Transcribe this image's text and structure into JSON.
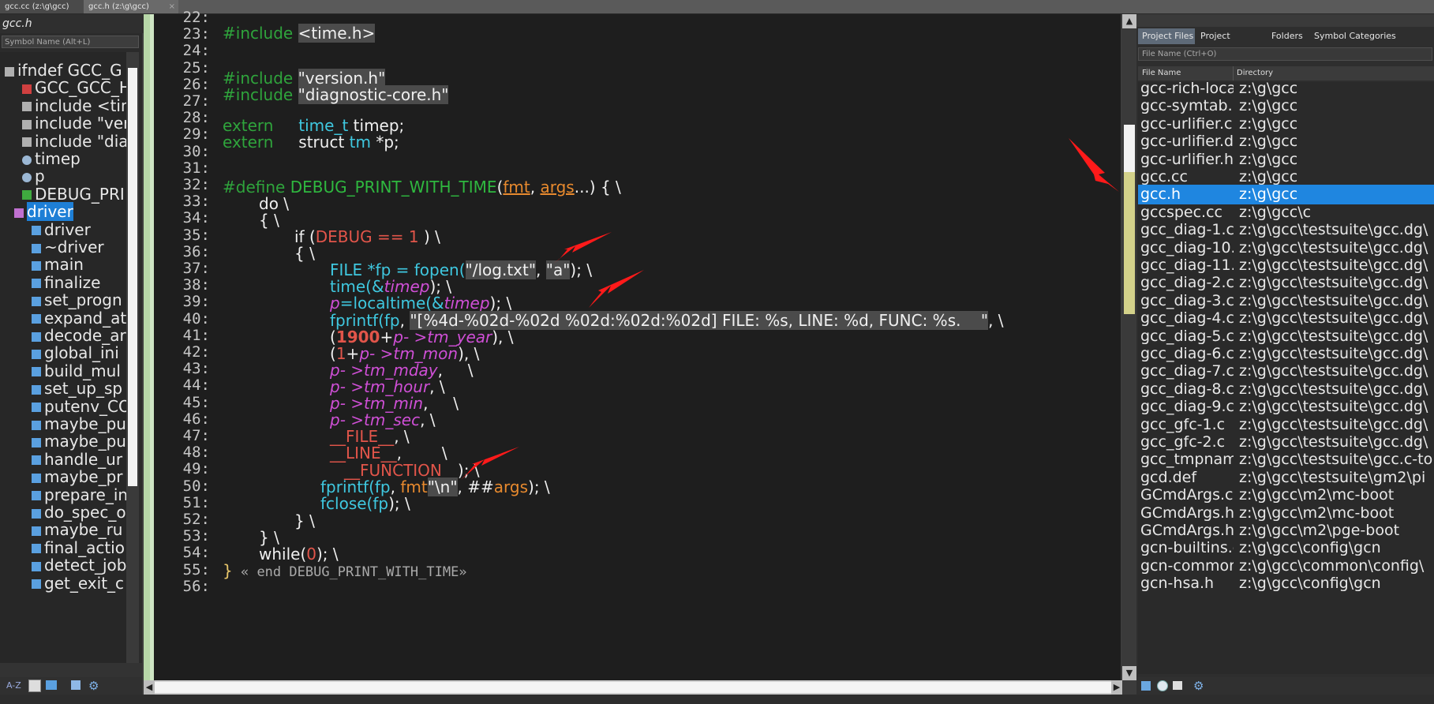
{
  "tabs": [
    {
      "label": "gcc.cc (z:\\g\\gcc)"
    },
    {
      "label": "gcc.h (z:\\g\\gcc)",
      "close": "×"
    }
  ],
  "left_panel": {
    "file_name": "gcc.h",
    "search_placeholder": "Symbol Name (Alt+L)",
    "symbols": [
      {
        "label": "ifndef GCC_G",
        "icon": "hash-icon"
      },
      {
        "label": "GCC_GCC_H",
        "icon": "define-icon"
      },
      {
        "label": "include <tim",
        "icon": "hash-icon"
      },
      {
        "label": "include \"ver",
        "icon": "hash-icon"
      },
      {
        "label": "include \"dia",
        "icon": "hash-icon"
      },
      {
        "label": "timep",
        "icon": "variable-icon"
      },
      {
        "label": "p",
        "icon": "variable-icon"
      },
      {
        "label": "DEBUG_PRI",
        "icon": "macro-icon"
      },
      {
        "label": "driver",
        "icon": "class-icon"
      },
      {
        "label": "driver",
        "icon": "method-icon"
      },
      {
        "label": "~driver",
        "icon": "method-icon"
      },
      {
        "label": "main",
        "icon": "method-icon"
      },
      {
        "label": "finalize",
        "icon": "method-icon"
      },
      {
        "label": "set_progn",
        "icon": "method-icon"
      },
      {
        "label": "expand_at",
        "icon": "method-icon"
      },
      {
        "label": "decode_ar",
        "icon": "method-icon"
      },
      {
        "label": "global_ini",
        "icon": "method-icon"
      },
      {
        "label": "build_mul",
        "icon": "method-icon"
      },
      {
        "label": "set_up_sp",
        "icon": "method-icon"
      },
      {
        "label": "putenv_CO",
        "icon": "method-icon"
      },
      {
        "label": "maybe_pu",
        "icon": "method-icon"
      },
      {
        "label": "maybe_pu",
        "icon": "method-icon"
      },
      {
        "label": "handle_ur",
        "icon": "method-icon"
      },
      {
        "label": "maybe_pr",
        "icon": "method-icon"
      },
      {
        "label": "prepare_in",
        "icon": "method-icon"
      },
      {
        "label": "do_spec_o",
        "icon": "method-icon"
      },
      {
        "label": "maybe_ru",
        "icon": "method-icon"
      },
      {
        "label": "final_actio",
        "icon": "method-icon"
      },
      {
        "label": "detect_job",
        "icon": "method-icon"
      },
      {
        "label": "get_exit_c",
        "icon": "method-icon"
      }
    ],
    "selected_index": 8,
    "toolbar": {
      "az": "A-Z"
    }
  },
  "editor": {
    "line_numbers": [
      "22:",
      "23:",
      "24:",
      "25:",
      "26:",
      "27:",
      "28:",
      "29:",
      "30:",
      "31:",
      "32:",
      "33:",
      "34:",
      "35:",
      "36:",
      "37:",
      "38:",
      "39:",
      "40:",
      "41:",
      "42:",
      "43:",
      "44:",
      "45:",
      "46:",
      "47:",
      "48:",
      "49:",
      "50:",
      "51:",
      "52:",
      "53:",
      "54:",
      "55:",
      "56:"
    ],
    "lines": {
      "l23_kw": "#include",
      "l23_str": "<time.h>",
      "l26_kw": "#include",
      "l26_str": "\"version.h\"",
      "l27_kw": "#include",
      "l27_str": "\"diagnostic-core.h\"",
      "l29_kw": "extern",
      "l29_type": "time_t",
      "l29_rest": " timep;",
      "l30_kw": "extern",
      "l30_a": "struct ",
      "l30_type": "tm",
      "l30_b": " *p;",
      "l33_kw": "#define",
      "l33_name": "DEBUG_PRINT_WITH_TIME",
      "l33_p1": "(",
      "l33_a1": "fmt",
      "l33_c": ", ",
      "l33_a2": "args",
      "l33_p2": "...) { \\",
      "l34": "do \\",
      "l35": "{ \\",
      "l36_a": "if (",
      "l36_b": "DEBUG == 1",
      "l36_c": " ) \\",
      "l37": "{ \\",
      "l38_a": "FILE *",
      "l38_b": "fp",
      "l38_c": " = fopen(",
      "l38_s1": "\"/log.txt\"",
      "l38_d": ", ",
      "l38_s2": "\"a\"",
      "l38_e": "); \\",
      "l39_a": "time(&",
      "l39_b": "timep",
      "l39_c": "); \\",
      "l40_a": "p",
      "l40_b": "=localtime(&",
      "l40_c": "timep",
      "l40_d": "); \\",
      "l41_a": "fprintf(",
      "l41_b": "fp",
      "l41_c": ", ",
      "l41_s": "\"[%4d-%02d-%02d %02d:%02d:%02d] FILE: %s, LINE: %d, FUNC: %s.    \"",
      "l41_d": ", \\",
      "l42_a": "(",
      "l42_b": "1900",
      "l42_c": "+",
      "l42_d": "p",
      "l42_e": "- >tm_year",
      "l42_f": "), \\",
      "l43_a": "(",
      "l43_b": "1",
      "l43_c": "+",
      "l43_d": "p",
      "l43_e": "- >tm_mon",
      "l43_f": "), \\",
      "l44_a": "p",
      "l44_b": "- >tm_mday",
      "l44_c": ",     \\",
      "l45_a": "p",
      "l45_b": "- >tm_hour",
      "l45_c": ", \\",
      "l46_a": "p",
      "l46_b": "- >tm_min",
      "l46_c": ",     \\",
      "l47_a": "p",
      "l47_b": "- >tm_sec",
      "l47_c": ", \\",
      "l48_a": "__FILE__",
      "l48_b": ", \\",
      "l49_a": "__LINE__",
      "l49_b": ",        \\",
      "l50_a": "__FUNCTION__",
      "l50_b": "); \\",
      "l51_a": "fprintf(",
      "l51_b": "fp",
      "l51_c": ", ",
      "l51_d": "fmt",
      "l51_s": "\"\\n\"",
      "l51_e": ", ##",
      "l51_f": "args",
      "l51_g": "); \\",
      "l52_a": "fclose(",
      "l52_b": "fp",
      "l52_c": "); \\",
      "l53": "} \\",
      "l54": "} \\",
      "l55_a": "while(",
      "l55_b": "0",
      "l55_c": "); \\",
      "l56_a": "}",
      "l56_b": " « end DEBUG_PRINT_WITH_TIME»"
    },
    "scroll": {
      "up": "▲",
      "down": "▼",
      "left": "◀",
      "right": "▶"
    }
  },
  "right_panel": {
    "tabs": [
      "Project Files",
      "Project Symbols",
      "Folders",
      "Symbol Categories"
    ],
    "active_tab": 0,
    "search_placeholder": "File Name (Ctrl+O)",
    "col_file": "File Name",
    "col_dir": "Directory",
    "files": [
      {
        "name": "gcc-rich-loca",
        "dir": "z:\\g\\gcc"
      },
      {
        "name": "gcc-symtab.h",
        "dir": "z:\\g\\gcc"
      },
      {
        "name": "gcc-urlifier.c",
        "dir": "z:\\g\\gcc"
      },
      {
        "name": "gcc-urlifier.d",
        "dir": "z:\\g\\gcc"
      },
      {
        "name": "gcc-urlifier.h",
        "dir": "z:\\g\\gcc"
      },
      {
        "name": "gcc.cc",
        "dir": "z:\\g\\gcc"
      },
      {
        "name": "gcc.h",
        "dir": "z:\\g\\gcc"
      },
      {
        "name": "gccspec.cc",
        "dir": "z:\\g\\gcc\\c"
      },
      {
        "name": "gcc_diag-1.c",
        "dir": "z:\\g\\gcc\\testsuite\\gcc.dg\\"
      },
      {
        "name": "gcc_diag-10.",
        "dir": "z:\\g\\gcc\\testsuite\\gcc.dg\\"
      },
      {
        "name": "gcc_diag-11.",
        "dir": "z:\\g\\gcc\\testsuite\\gcc.dg\\"
      },
      {
        "name": "gcc_diag-2.c",
        "dir": "z:\\g\\gcc\\testsuite\\gcc.dg\\"
      },
      {
        "name": "gcc_diag-3.c",
        "dir": "z:\\g\\gcc\\testsuite\\gcc.dg\\"
      },
      {
        "name": "gcc_diag-4.c",
        "dir": "z:\\g\\gcc\\testsuite\\gcc.dg\\"
      },
      {
        "name": "gcc_diag-5.c",
        "dir": "z:\\g\\gcc\\testsuite\\gcc.dg\\"
      },
      {
        "name": "gcc_diag-6.c",
        "dir": "z:\\g\\gcc\\testsuite\\gcc.dg\\"
      },
      {
        "name": "gcc_diag-7.c",
        "dir": "z:\\g\\gcc\\testsuite\\gcc.dg\\"
      },
      {
        "name": "gcc_diag-8.c",
        "dir": "z:\\g\\gcc\\testsuite\\gcc.dg\\"
      },
      {
        "name": "gcc_diag-9.c",
        "dir": "z:\\g\\gcc\\testsuite\\gcc.dg\\"
      },
      {
        "name": "gcc_gfc-1.c",
        "dir": "z:\\g\\gcc\\testsuite\\gcc.dg\\"
      },
      {
        "name": "gcc_gfc-2.c",
        "dir": "z:\\g\\gcc\\testsuite\\gcc.dg\\"
      },
      {
        "name": "gcc_tmpnam",
        "dir": "z:\\g\\gcc\\testsuite\\gcc.c-to"
      },
      {
        "name": "gcd.def",
        "dir": "z:\\g\\gcc\\testsuite\\gm2\\pi"
      },
      {
        "name": "GCmdArgs.cc",
        "dir": "z:\\g\\gcc\\m2\\mc-boot"
      },
      {
        "name": "GCmdArgs.h",
        "dir": "z:\\g\\gcc\\m2\\mc-boot"
      },
      {
        "name": "GCmdArgs.h",
        "dir": "z:\\g\\gcc\\m2\\pge-boot"
      },
      {
        "name": "gcn-builtins.c",
        "dir": "z:\\g\\gcc\\config\\gcn"
      },
      {
        "name": "gcn-common",
        "dir": "z:\\g\\gcc\\common\\config\\"
      },
      {
        "name": "gcn-hsa.h",
        "dir": "z:\\g\\gcc\\config\\gcn"
      }
    ],
    "selected_index": 6
  },
  "colors": {
    "selection": "#1f86e0",
    "arrow": "#ff1a1a"
  }
}
